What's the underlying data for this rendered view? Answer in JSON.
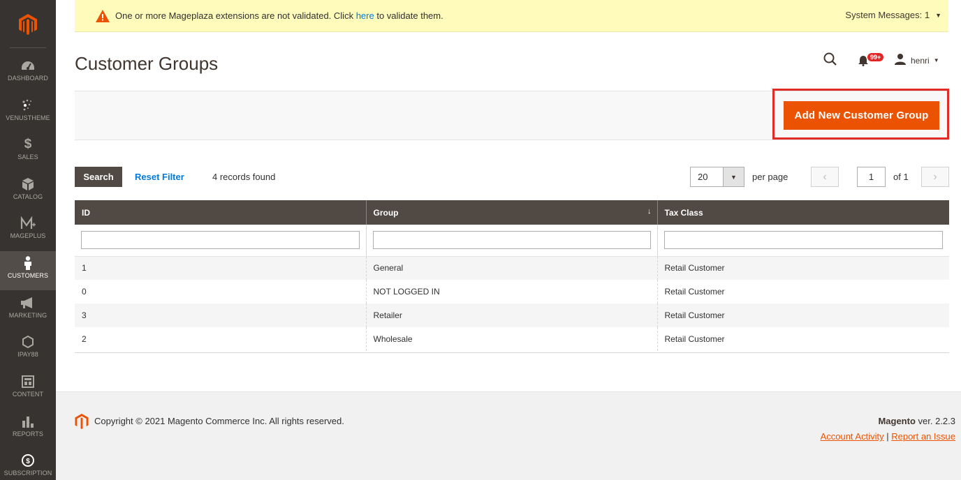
{
  "sidebar": {
    "logo_icon": "magento-logo",
    "items": [
      {
        "label": "DASHBOARD",
        "icon": "speedometer-icon"
      },
      {
        "label": "VENUSTHEME",
        "icon": "sparkle-icon"
      },
      {
        "label": "SALES",
        "icon": "dollar-icon"
      },
      {
        "label": "CATALOG",
        "icon": "cube-icon"
      },
      {
        "label": "MAGEPLUS",
        "icon": "mageplus-icon"
      },
      {
        "label": "CUSTOMERS",
        "icon": "person-icon"
      },
      {
        "label": "MARKETING",
        "icon": "megaphone-icon"
      },
      {
        "label": "IPAY88",
        "icon": "hexagon-icon"
      },
      {
        "label": "CONTENT",
        "icon": "layout-icon"
      },
      {
        "label": "REPORTS",
        "icon": "bar-chart-icon"
      },
      {
        "label": "SUBSCRIPTION",
        "icon": "subscription-icon"
      }
    ],
    "active": "CUSTOMERS"
  },
  "system_message": {
    "text_before": "One or more Mageplaza extensions are not validated. Click ",
    "link_text": "here",
    "text_after": " to validate them.",
    "right_label": "System Messages: 1"
  },
  "header": {
    "title": "Customer Groups",
    "notification_count": "99+",
    "user_name": "henri"
  },
  "actions": {
    "add_button_label": "Add New Customer Group"
  },
  "grid_toolbar": {
    "search_label": "Search",
    "reset_label": "Reset Filter",
    "records_found": "4 records found",
    "per_page_value": "20",
    "per_page_label": "per page",
    "current_page": "1",
    "of_pages": "of 1"
  },
  "table": {
    "columns": [
      "ID",
      "Group",
      "Tax Class"
    ],
    "sort_indicator": "↓",
    "rows": [
      {
        "id": "1",
        "group": "General",
        "tax_class": "Retail Customer"
      },
      {
        "id": "0",
        "group": "NOT LOGGED IN",
        "tax_class": "Retail Customer"
      },
      {
        "id": "3",
        "group": "Retailer",
        "tax_class": "Retail Customer"
      },
      {
        "id": "2",
        "group": "Wholesale",
        "tax_class": "Retail Customer"
      }
    ]
  },
  "footer": {
    "copyright": "Copyright © 2021 Magento Commerce Inc. All rights reserved.",
    "brand": "Magento",
    "version": " ver. 2.2.3",
    "account_activity": "Account Activity",
    "separator": " | ",
    "report_issue": "Report an Issue"
  },
  "colors": {
    "accent": "#eb5202",
    "sidebar_bg": "#373330",
    "header_bg": "#514943",
    "highlight": "#e02b27"
  }
}
